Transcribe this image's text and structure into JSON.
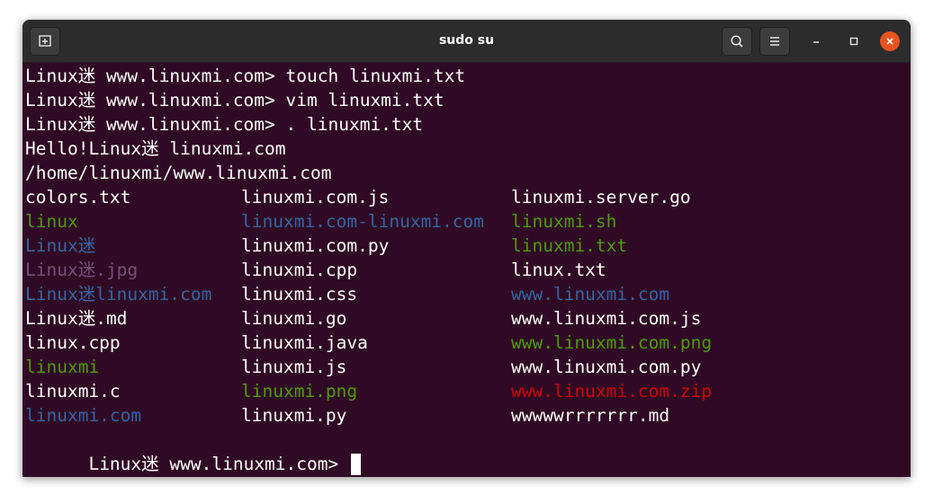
{
  "window": {
    "title": "sudo su"
  },
  "icons": {
    "new_tab": "new-tab-icon",
    "search": "search-icon",
    "menu": "hamburger-menu-icon",
    "minimize": "minimize-icon",
    "maximize": "maximize-icon",
    "close": "close-icon"
  },
  "colors": {
    "terminal_bg": "#300a24",
    "titlebar_bg": "#2c2c2c",
    "close_button": "#e95420",
    "ls_green": "#4e9a06",
    "ls_blue": "#3465a4",
    "ls_purple": "#75507b",
    "ls_red": "#cc0000"
  },
  "terminal": {
    "lines": [
      "Linux迷 www.linuxmi.com> touch linuxmi.txt",
      "Linux迷 www.linuxmi.com> vim linuxmi.txt",
      "Linux迷 www.linuxmi.com> . linuxmi.txt",
      "Hello!Linux迷 linuxmi.com",
      "/home/linuxmi/www.linuxmi.com"
    ],
    "ls_rows": [
      [
        {
          "text": "colors.txt",
          "color": "white"
        },
        {
          "text": "linuxmi.com.js",
          "color": "white"
        },
        {
          "text": "linuxmi.server.go",
          "color": "white"
        }
      ],
      [
        {
          "text": "linux",
          "color": "green"
        },
        {
          "text": "linuxmi.com-linuxmi.com",
          "color": "blue"
        },
        {
          "text": "linuxmi.sh",
          "color": "green"
        }
      ],
      [
        {
          "text": "Linux迷",
          "color": "blue"
        },
        {
          "text": "linuxmi.com.py",
          "color": "white"
        },
        {
          "text": "linuxmi.txt",
          "color": "green"
        }
      ],
      [
        {
          "text": "Linux迷.jpg",
          "color": "purple"
        },
        {
          "text": "linuxmi.cpp",
          "color": "white"
        },
        {
          "text": "linux.txt",
          "color": "white"
        }
      ],
      [
        {
          "text": "Linux迷linuxmi.com",
          "color": "blue"
        },
        {
          "text": "linuxmi.css",
          "color": "white"
        },
        {
          "text": "www.linuxmi.com",
          "color": "blue"
        }
      ],
      [
        {
          "text": "Linux迷.md",
          "color": "white"
        },
        {
          "text": "linuxmi.go",
          "color": "white"
        },
        {
          "text": "www.linuxmi.com.js",
          "color": "white"
        }
      ],
      [
        {
          "text": "linux.cpp",
          "color": "white"
        },
        {
          "text": "linuxmi.java",
          "color": "white"
        },
        {
          "text": "www.linuxmi.com.png",
          "color": "green"
        }
      ],
      [
        {
          "text": "linuxmi",
          "color": "green"
        },
        {
          "text": "linuxmi.js",
          "color": "white"
        },
        {
          "text": "www.linuxmi.com.py",
          "color": "white"
        }
      ],
      [
        {
          "text": "linuxmi.c",
          "color": "white"
        },
        {
          "text": "linuxmi.png",
          "color": "green"
        },
        {
          "text": "www.linuxmi.com.zip",
          "color": "red"
        }
      ],
      [
        {
          "text": "linuxmi.com",
          "color": "blue"
        },
        {
          "text": "linuxmi.py",
          "color": "white"
        },
        {
          "text": "wwwwwrrrrrrr.md",
          "color": "white"
        }
      ]
    ],
    "prompt": "Linux迷 www.linuxmi.com> "
  }
}
